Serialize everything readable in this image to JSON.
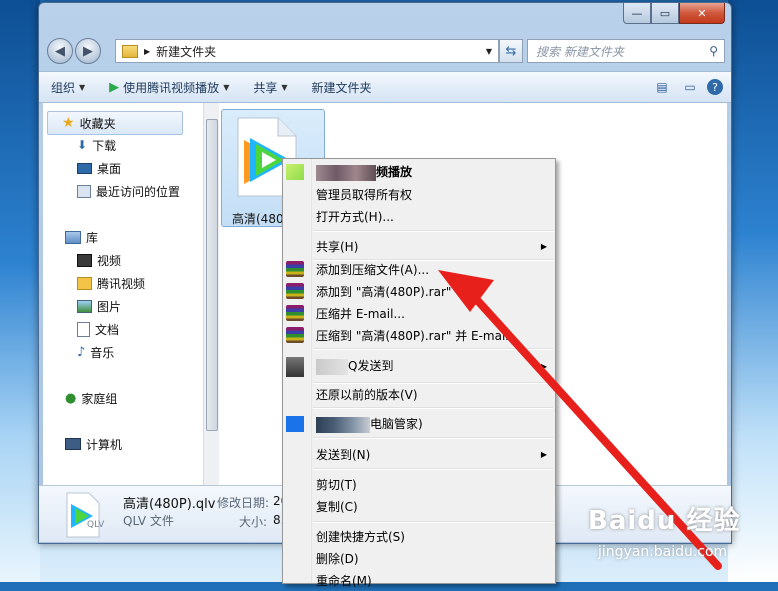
{
  "window": {
    "address_path": "新建文件夹",
    "search_placeholder": "搜索 新建文件夹",
    "caption": {
      "min": "—",
      "max": "▭",
      "close": "✕"
    }
  },
  "toolbar": {
    "organize": "组织",
    "play_with": "使用腾讯视频播放",
    "share": "共享",
    "new_folder": "新建文件夹"
  },
  "nav": {
    "favorites": "收藏夹",
    "downloads": "下载",
    "desktop": "桌面",
    "recent": "最近访问的位置",
    "libraries": "库",
    "videos": "视频",
    "tencent_video": "腾讯视频",
    "pictures": "图片",
    "documents": "文档",
    "music": "音乐",
    "homegroup": "家庭组",
    "computer": "计算机"
  },
  "file": {
    "tile_label": "高清(480",
    "name": "高清(480P).qlv",
    "type": "QLV 文件",
    "modified_label": "修改日期:",
    "modified_value": "20",
    "size_label": "大小:",
    "size_value": "8.",
    "icon_ext": "QLV"
  },
  "context_menu": {
    "items": [
      {
        "label": "频播放"
      },
      {
        "label": "管理员取得所有权"
      },
      {
        "label": "打开方式(H)..."
      },
      {
        "label": "共享(H)"
      },
      {
        "label": "添加到压缩文件(A)..."
      },
      {
        "label": "添加到 \"高清(480P).rar\""
      },
      {
        "label": "压缩并 E-mail..."
      },
      {
        "label": "压缩到 \"高清(480P).rar\" 并 E-mail"
      },
      {
        "label": "Q发送到"
      },
      {
        "label": "还原以前的版本(V)"
      },
      {
        "label": "电脑管家)"
      },
      {
        "label": "发送到(N)"
      },
      {
        "label": "剪切(T)"
      },
      {
        "label": "复制(C)"
      },
      {
        "label": "创建快捷方式(S)"
      },
      {
        "label": "删除(D)"
      },
      {
        "label": "重命名(M)"
      }
    ]
  },
  "watermark": {
    "logo": "Baidu 经验",
    "url": "jingyan.baidu.com"
  },
  "colors": {
    "arrow": "#e8201c",
    "accent": "#2f6aa8"
  }
}
